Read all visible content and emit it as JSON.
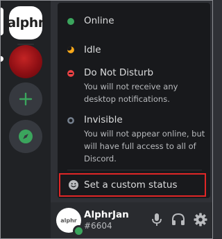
{
  "server_rail": {
    "logo_text": "alphr",
    "items": [
      "alphr-server",
      "red-server",
      "add-server",
      "explore-servers"
    ]
  },
  "status_menu": {
    "items": [
      {
        "key": "online",
        "label": "Online",
        "color": "#3ba55d"
      },
      {
        "key": "idle",
        "label": "Idle",
        "color": "#faa81a"
      },
      {
        "key": "dnd",
        "label": "Do Not Disturb",
        "description": "You will not receive any desktop notifications.",
        "color": "#ed4245"
      },
      {
        "key": "invisible",
        "label": "Invisible",
        "description": "You will not appear online, but will have full access to all of Discord.",
        "color": "#747f8d"
      }
    ],
    "custom_status": {
      "label": "Set a custom status",
      "icon": "smiley-icon"
    }
  },
  "user_panel": {
    "avatar_text": "alphr",
    "username": "AlphrJan",
    "discriminator": "#6604",
    "status_color": "#3ba55d",
    "buttons": [
      "microphone-icon",
      "headphones-icon",
      "settings-gear-icon"
    ]
  },
  "colors": {
    "highlight_border": "#e02626",
    "rail_background": "#202225",
    "menu_background": "#18191c"
  }
}
